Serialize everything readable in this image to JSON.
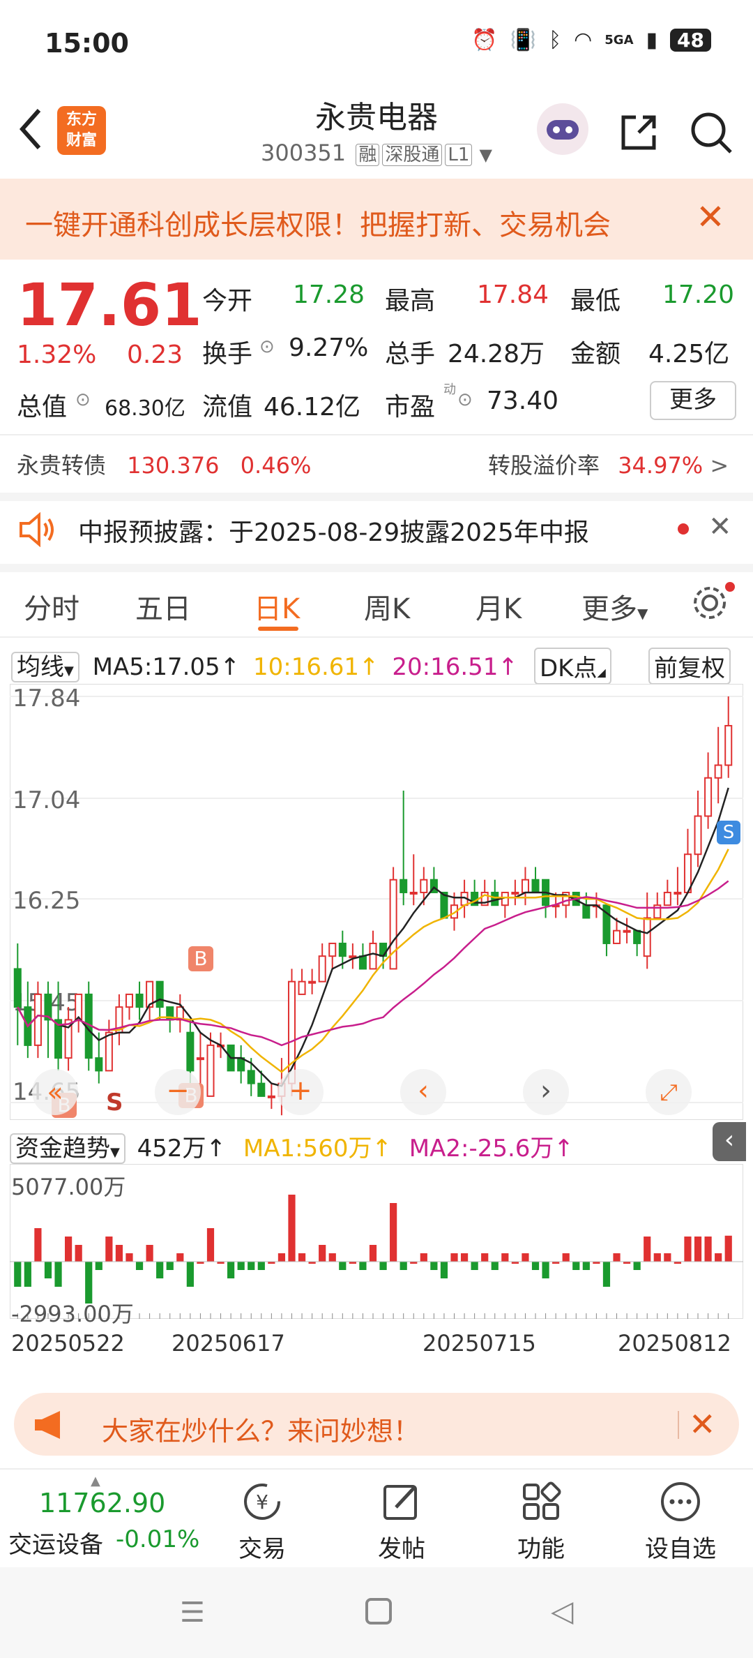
{
  "status": {
    "time": "15:00",
    "signal": "5GA",
    "battery": "48"
  },
  "header": {
    "name": "永贵电器",
    "code": "300351",
    "tags": [
      "融",
      "深股通",
      "L1"
    ],
    "logo_line1": "东方",
    "logo_line2": "财富"
  },
  "banner": {
    "text": "一键开通科创成长层权限！把握打新、交易机会"
  },
  "quote": {
    "price": "17.61",
    "change_pct": "1.32%",
    "change": "0.23",
    "open_label": "今开",
    "open": "17.28",
    "high_label": "最高",
    "high": "17.84",
    "low_label": "最低",
    "low": "17.20",
    "turnover_label": "换手",
    "turnover": "9.27%",
    "volume_label": "总手",
    "volume": "24.28万",
    "amount_label": "金额",
    "amount": "4.25亿",
    "mcap_label": "总值",
    "mcap": "68.30亿",
    "float_label": "流值",
    "float": "46.12亿",
    "pe_label": "市盈",
    "pe_sup": "动",
    "pe": "73.40",
    "more": "更多"
  },
  "convertible": {
    "name": "永贵转债",
    "price": "130.376",
    "pct": "0.46%",
    "premium_label": "转股溢价率",
    "premium": "34.97%"
  },
  "notice": {
    "text": "中报预披露：于2025-08-29披露2025年中报"
  },
  "tabs": [
    {
      "label": "分时"
    },
    {
      "label": "五日"
    },
    {
      "label": "日K"
    },
    {
      "label": "周K"
    },
    {
      "label": "月K"
    },
    {
      "label": "更多"
    }
  ],
  "ma": {
    "select": "均线",
    "ma5": "MA5:17.05",
    "ma10": "10:16.61",
    "ma20": "20:16.51",
    "dk": "DK点",
    "adjust": "前复权"
  },
  "price_axis": [
    "17.84",
    "17.04",
    "16.25",
    "15.45",
    "14.65"
  ],
  "fund": {
    "select": "资金趋势",
    "value": "452万",
    "ma1": "MA1:560万",
    "ma2": "MA2:-25.6万",
    "top": "5077.00万",
    "bottom": "-2993.00万"
  },
  "dates": [
    "20250522",
    "20250617",
    "20250715",
    "20250812"
  ],
  "markers": {
    "b": "B",
    "s": "S"
  },
  "promo": {
    "text": "大家在炒什么？来问妙想！"
  },
  "bottom": {
    "index_value": "11762.90",
    "index_name": "交运设备",
    "index_chg": "-0.01%",
    "items": [
      {
        "label": "交易"
      },
      {
        "label": "发帖"
      },
      {
        "label": "功能"
      },
      {
        "label": "设自选"
      }
    ]
  },
  "colors": {
    "up": "#e03131",
    "down": "#1a9a2e",
    "accent": "#f36c21",
    "ma5": "#222222",
    "ma10": "#f0b400",
    "ma20": "#c81e8c"
  },
  "chart_data": {
    "type": "candlestick",
    "ylim": [
      14.65,
      17.84
    ],
    "candles": [
      {
        "o": 15.7,
        "h": 15.9,
        "l": 15.1,
        "c": 15.4
      },
      {
        "o": 15.4,
        "h": 15.6,
        "l": 15.0,
        "c": 15.1
      },
      {
        "o": 15.1,
        "h": 15.6,
        "l": 15.0,
        "c": 15.5
      },
      {
        "o": 15.5,
        "h": 15.6,
        "l": 15.0,
        "c": 15.3
      },
      {
        "o": 15.3,
        "h": 15.6,
        "l": 14.9,
        "c": 15.0
      },
      {
        "o": 15.0,
        "h": 15.4,
        "l": 14.9,
        "c": 15.3
      },
      {
        "o": 15.3,
        "h": 15.5,
        "l": 15.2,
        "c": 15.5
      },
      {
        "o": 15.5,
        "h": 15.6,
        "l": 14.9,
        "c": 15.0
      },
      {
        "o": 15.0,
        "h": 15.2,
        "l": 14.8,
        "c": 14.9
      },
      {
        "o": 14.9,
        "h": 15.3,
        "l": 14.9,
        "c": 15.2
      },
      {
        "o": 15.2,
        "h": 15.5,
        "l": 15.1,
        "c": 15.4
      },
      {
        "o": 15.4,
        "h": 15.5,
        "l": 15.3,
        "c": 15.5
      },
      {
        "o": 15.5,
        "h": 15.6,
        "l": 15.3,
        "c": 15.4
      },
      {
        "o": 15.4,
        "h": 15.6,
        "l": 15.3,
        "c": 15.6
      },
      {
        "o": 15.6,
        "h": 15.6,
        "l": 15.3,
        "c": 15.4
      },
      {
        "o": 15.4,
        "h": 15.4,
        "l": 15.2,
        "c": 15.3
      },
      {
        "o": 15.3,
        "h": 15.5,
        "l": 15.2,
        "c": 15.4
      },
      {
        "o": 15.2,
        "h": 15.3,
        "l": 14.8,
        "c": 14.9
      },
      {
        "o": 15.0,
        "h": 15.2,
        "l": 14.8,
        "c": 15.0
      },
      {
        "o": 14.7,
        "h": 15.2,
        "l": 14.7,
        "c": 15.1
      },
      {
        "o": 15.1,
        "h": 15.2,
        "l": 15.0,
        "c": 15.1
      },
      {
        "o": 15.1,
        "h": 15.1,
        "l": 14.9,
        "c": 14.9
      },
      {
        "o": 15.0,
        "h": 15.1,
        "l": 14.8,
        "c": 14.9
      },
      {
        "o": 14.9,
        "h": 15.0,
        "l": 14.7,
        "c": 14.8
      },
      {
        "o": 14.8,
        "h": 14.9,
        "l": 14.7,
        "c": 14.7
      },
      {
        "o": 14.7,
        "h": 14.8,
        "l": 14.6,
        "c": 14.7
      },
      {
        "o": 14.7,
        "h": 15.0,
        "l": 14.55,
        "c": 14.8
      },
      {
        "o": 14.8,
        "h": 15.7,
        "l": 14.7,
        "c": 15.6
      },
      {
        "o": 15.5,
        "h": 15.7,
        "l": 15.5,
        "c": 15.6
      },
      {
        "o": 15.6,
        "h": 15.7,
        "l": 15.5,
        "c": 15.6
      },
      {
        "o": 15.6,
        "h": 15.9,
        "l": 15.6,
        "c": 15.8
      },
      {
        "o": 15.8,
        "h": 15.9,
        "l": 15.7,
        "c": 15.9
      },
      {
        "o": 15.9,
        "h": 16.0,
        "l": 15.7,
        "c": 15.8
      },
      {
        "o": 15.8,
        "h": 15.9,
        "l": 15.7,
        "c": 15.8
      },
      {
        "o": 15.8,
        "h": 15.9,
        "l": 15.7,
        "c": 15.7
      },
      {
        "o": 15.7,
        "h": 16.0,
        "l": 15.7,
        "c": 15.9
      },
      {
        "o": 15.9,
        "h": 15.9,
        "l": 15.7,
        "c": 15.8
      },
      {
        "o": 15.7,
        "h": 16.5,
        "l": 15.7,
        "c": 16.4
      },
      {
        "o": 16.4,
        "h": 17.1,
        "l": 16.2,
        "c": 16.3
      },
      {
        "o": 16.3,
        "h": 16.6,
        "l": 16.2,
        "c": 16.3
      },
      {
        "o": 16.3,
        "h": 16.5,
        "l": 16.2,
        "c": 16.4
      },
      {
        "o": 16.4,
        "h": 16.5,
        "l": 16.3,
        "c": 16.3
      },
      {
        "o": 16.3,
        "h": 16.3,
        "l": 16.1,
        "c": 16.1
      },
      {
        "o": 16.1,
        "h": 16.3,
        "l": 16.0,
        "c": 16.2
      },
      {
        "o": 16.2,
        "h": 16.4,
        "l": 16.1,
        "c": 16.3
      },
      {
        "o": 16.3,
        "h": 16.4,
        "l": 16.2,
        "c": 16.2
      },
      {
        "o": 16.2,
        "h": 16.4,
        "l": 16.2,
        "c": 16.3
      },
      {
        "o": 16.3,
        "h": 16.4,
        "l": 16.2,
        "c": 16.2
      },
      {
        "o": 16.2,
        "h": 16.3,
        "l": 16.1,
        "c": 16.3
      },
      {
        "o": 16.3,
        "h": 16.4,
        "l": 16.2,
        "c": 16.3
      },
      {
        "o": 16.3,
        "h": 16.5,
        "l": 16.2,
        "c": 16.4
      },
      {
        "o": 16.4,
        "h": 16.5,
        "l": 16.3,
        "c": 16.3
      },
      {
        "o": 16.4,
        "h": 16.4,
        "l": 16.1,
        "c": 16.2
      },
      {
        "o": 16.2,
        "h": 16.3,
        "l": 16.1,
        "c": 16.2
      },
      {
        "o": 16.2,
        "h": 16.3,
        "l": 16.1,
        "c": 16.3
      },
      {
        "o": 16.3,
        "h": 16.3,
        "l": 16.2,
        "c": 16.2
      },
      {
        "o": 16.2,
        "h": 16.3,
        "l": 16.1,
        "c": 16.1
      },
      {
        "o": 16.2,
        "h": 16.3,
        "l": 16.1,
        "c": 16.2
      },
      {
        "o": 16.2,
        "h": 16.2,
        "l": 15.8,
        "c": 15.9
      },
      {
        "o": 15.9,
        "h": 16.1,
        "l": 15.9,
        "c": 16.0
      },
      {
        "o": 16.0,
        "h": 16.1,
        "l": 15.9,
        "c": 16.0
      },
      {
        "o": 16.0,
        "h": 16.0,
        "l": 15.8,
        "c": 15.9
      },
      {
        "o": 15.8,
        "h": 16.3,
        "l": 15.7,
        "c": 16.1
      },
      {
        "o": 16.1,
        "h": 16.3,
        "l": 16.1,
        "c": 16.2
      },
      {
        "o": 16.2,
        "h": 16.4,
        "l": 16.2,
        "c": 16.3
      },
      {
        "o": 16.3,
        "h": 16.5,
        "l": 16.2,
        "c": 16.3
      },
      {
        "o": 16.3,
        "h": 16.8,
        "l": 16.3,
        "c": 16.6
      },
      {
        "o": 16.6,
        "h": 17.1,
        "l": 16.5,
        "c": 16.9
      },
      {
        "o": 16.9,
        "h": 17.4,
        "l": 16.8,
        "c": 17.2
      },
      {
        "o": 17.2,
        "h": 17.6,
        "l": 17.0,
        "c": 17.3
      },
      {
        "o": 17.3,
        "h": 17.84,
        "l": 17.2,
        "c": 17.61
      }
    ]
  }
}
